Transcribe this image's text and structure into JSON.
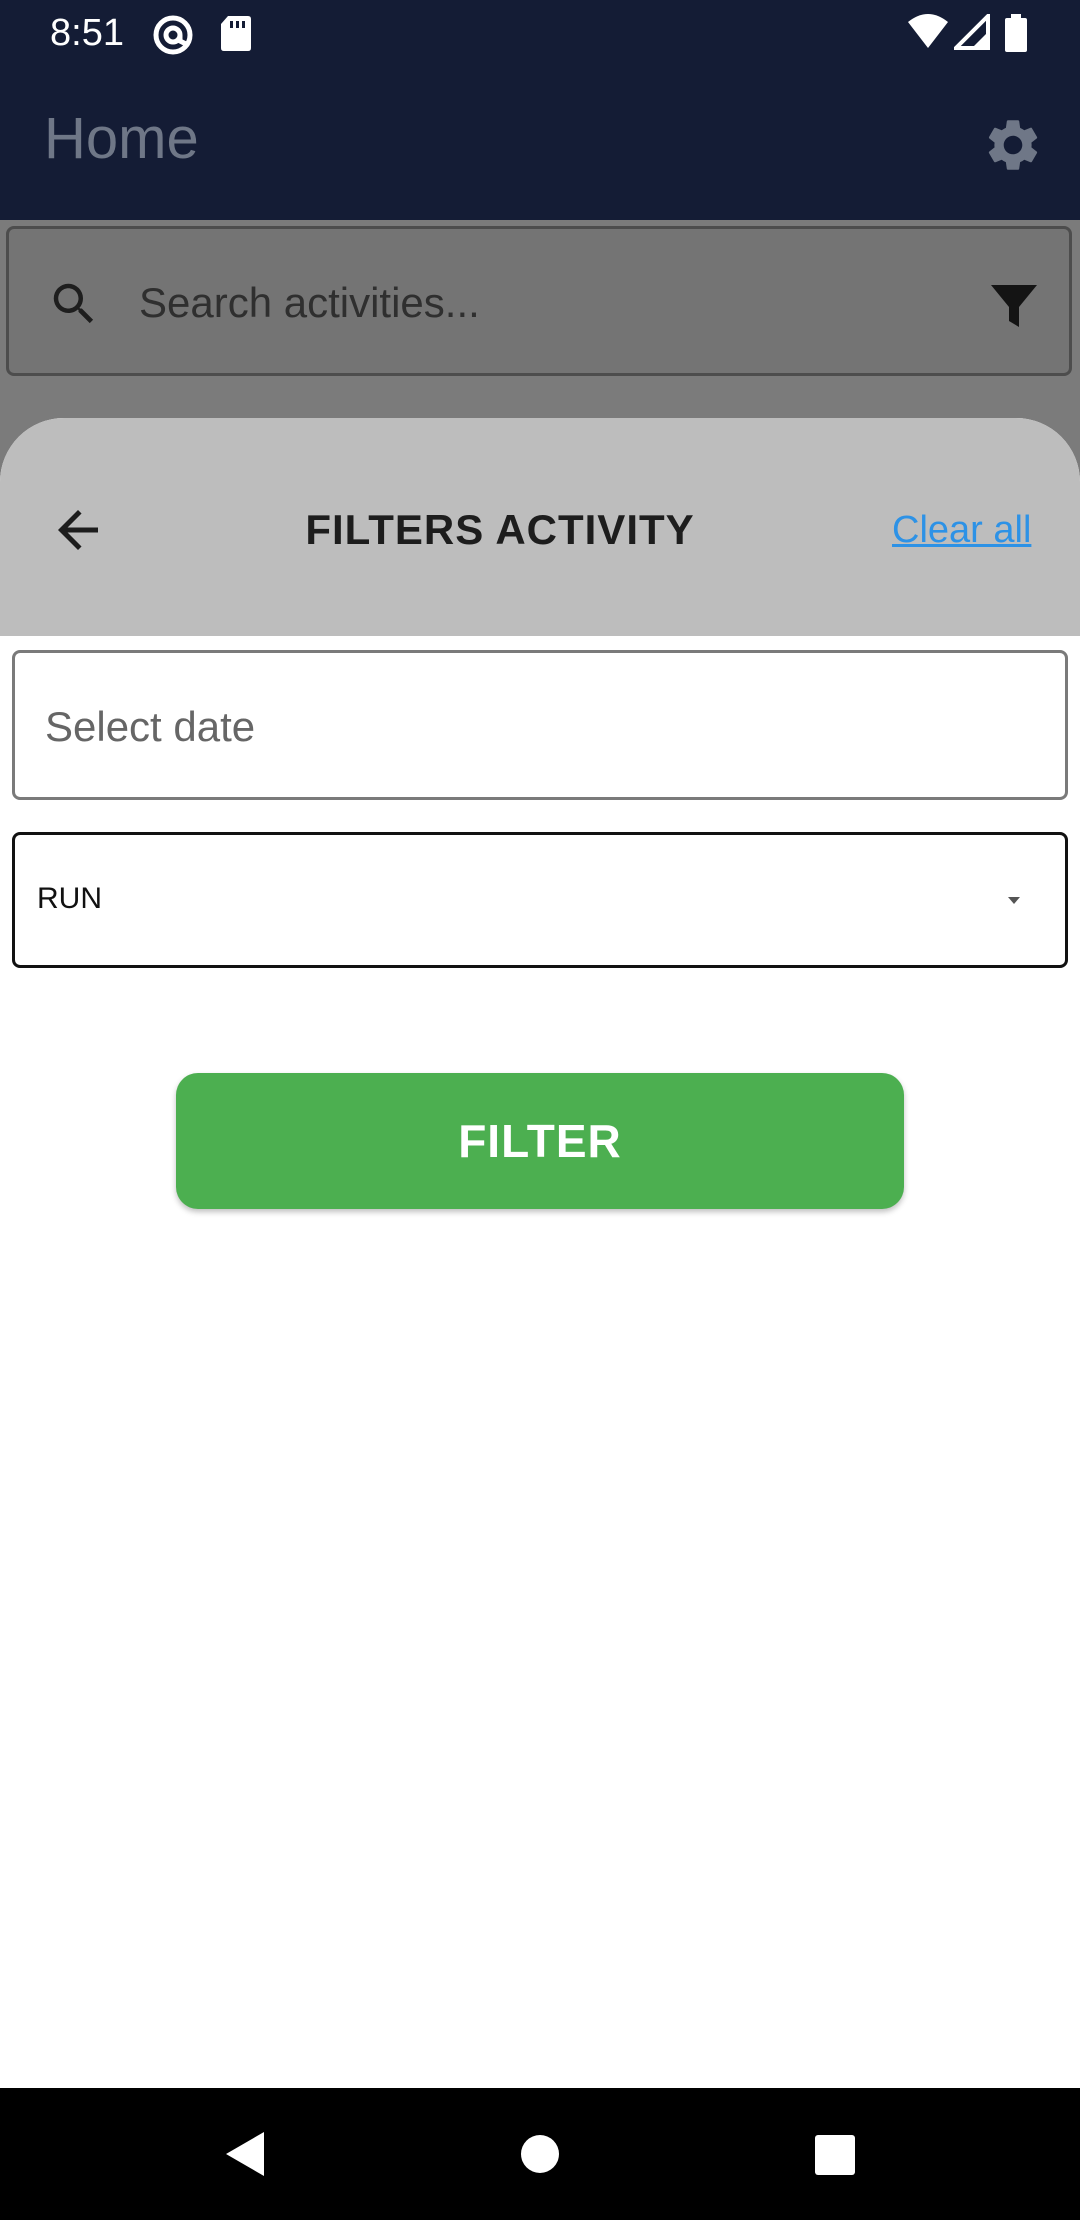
{
  "status_bar": {
    "time": "8:51",
    "icons": [
      "at-sign-icon",
      "sd-card-icon",
      "wifi-icon",
      "signal-icon",
      "battery-icon"
    ]
  },
  "app_bar": {
    "title": "Home",
    "settings_icon": "gear-icon"
  },
  "search": {
    "placeholder": "Search activities...",
    "search_icon": "search-icon",
    "filter_icon": "funnel-icon"
  },
  "sheet": {
    "title": "FILTERS ACTIVITY",
    "back_icon": "arrow-left-icon",
    "clear_all": "Clear all",
    "date_placeholder": "Select date",
    "activity_type": {
      "selected": "RUN"
    },
    "filter_button": "FILTER"
  },
  "nav_bar": {
    "buttons": [
      "back-triangle-icon",
      "home-circle-icon",
      "recents-square-icon"
    ]
  },
  "colors": {
    "app_bar": "#141c35",
    "scrim": "#7b7b7b",
    "sheet_header": "#bdbdbd",
    "accent_link": "#2d92e6",
    "filter_button": "#4caf50"
  }
}
